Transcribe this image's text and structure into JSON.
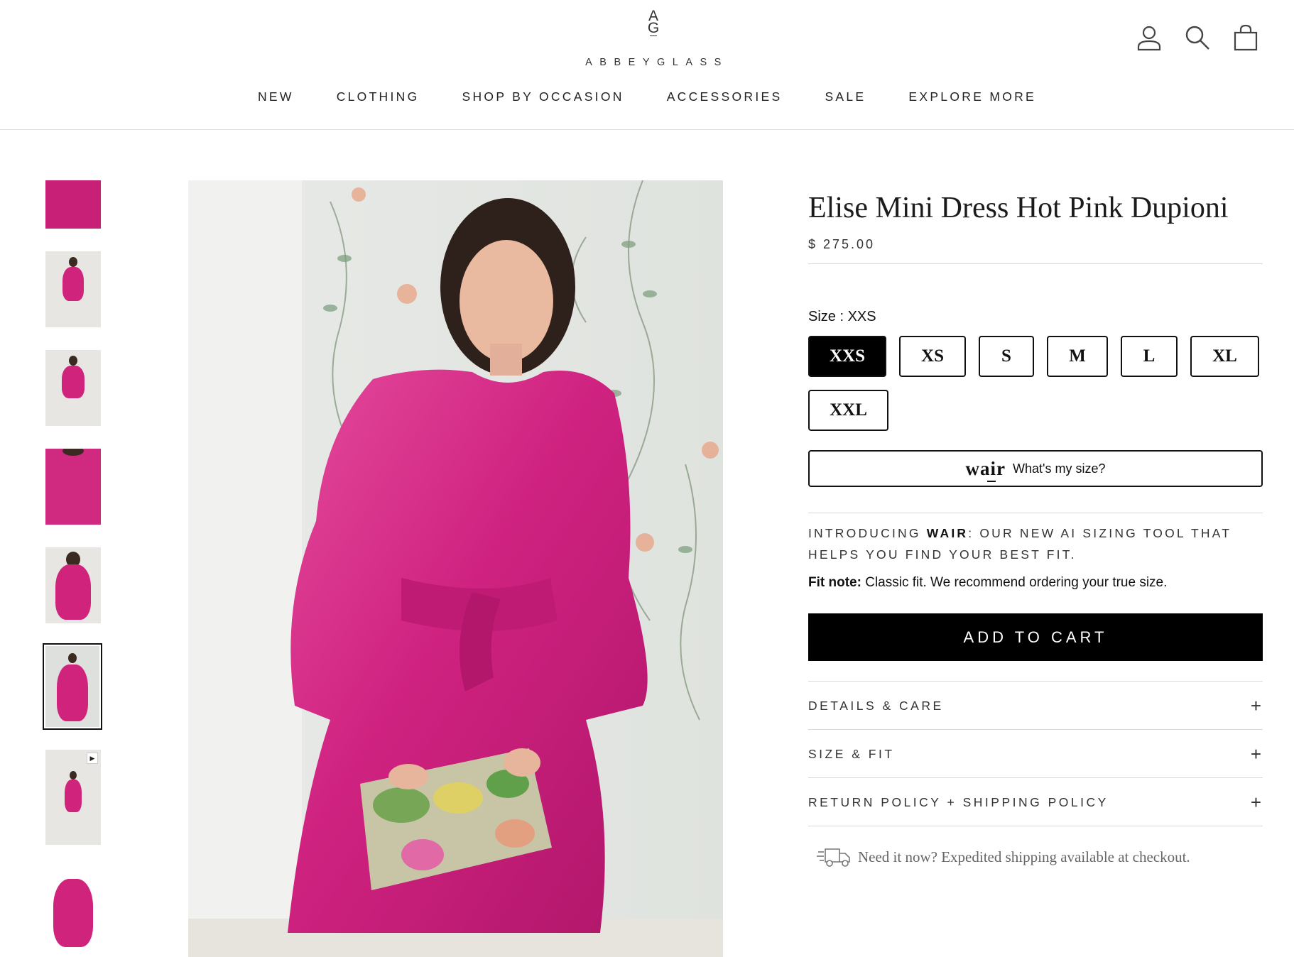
{
  "brand": {
    "mark_top": "A",
    "mark_bottom": "G",
    "wordmark": "ABBEYGLASS"
  },
  "header_icons": [
    "account-icon",
    "search-icon",
    "cart-icon"
  ],
  "nav": [
    "NEW",
    "CLOTHING",
    "SHOP BY OCCASION",
    "ACCESSORIES",
    "SALE",
    "EXPLORE MORE"
  ],
  "gallery": {
    "thumbnail_count": 8,
    "active_index": 5,
    "video_thumbnail_index": 6
  },
  "product": {
    "title": "Elise Mini Dress Hot Pink Dupioni",
    "price": "$ 275.00",
    "size_label": "Size : XXS",
    "sizes": [
      "XXS",
      "XS",
      "S",
      "M",
      "L",
      "XL",
      "XXL"
    ],
    "selected_size": "XXS",
    "wair_logo": "wair",
    "wair_button": "What's my size?",
    "intro_prefix": "INTRODUCING ",
    "intro_brand": "WAIR",
    "intro_rest": ": OUR NEW AI SIZING TOOL THAT HELPS YOU FIND YOUR BEST FIT.",
    "fit_note_label": "Fit note:",
    "fit_note_text": " Classic fit. We recommend ordering your true size.",
    "add_to_cart": "ADD TO CART",
    "accordions": [
      "DETAILS & CARE",
      "SIZE & FIT",
      "RETURN POLICY + SHIPPING POLICY"
    ],
    "shipping_note": "Need it now? Expedited shipping available at checkout."
  },
  "colors": {
    "dress_pink": "#d0247c",
    "button_black": "#000000",
    "text": "#1c1b1b"
  }
}
